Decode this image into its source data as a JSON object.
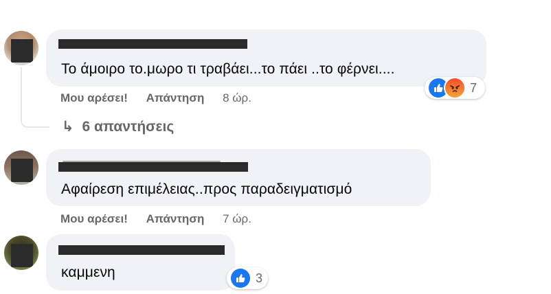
{
  "comments": [
    {
      "text": "Το άμοιρο το.μωρο τι τραβάει...το πάει ..το φέρνει....",
      "like_label": "Μου αρέσει!",
      "reply_label": "Απάντηση",
      "time": "8 ώρ.",
      "reactions": [
        "like-icon",
        "angry-icon"
      ],
      "reaction_count": "7"
    },
    {
      "text": "Αφαίρεση επιμέλειας..προς παραδειγματισμό",
      "like_label": "Μου αρέσει!",
      "reply_label": "Απάντηση",
      "time": "7 ώρ."
    },
    {
      "text": "καμμενη",
      "reactions": [
        "like-icon"
      ],
      "reaction_count": "3"
    }
  ],
  "replies_link": "6 απαντήσεις",
  "colors": {
    "like": "#1877f2",
    "bubble": "#f0f2f5",
    "meta": "#65676b"
  }
}
